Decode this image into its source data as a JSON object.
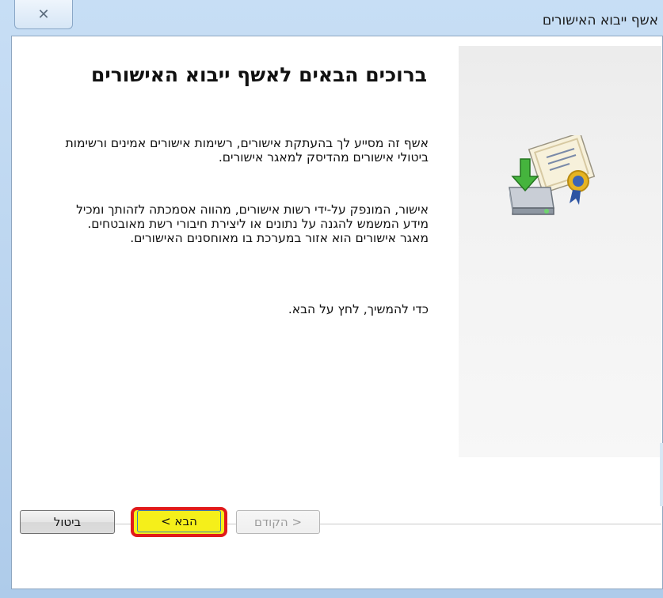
{
  "window": {
    "title": "אשף ייבוא האישורים",
    "close_glyph": "✕"
  },
  "main": {
    "heading": "ברוכים הבאים לאשף ייבוא האישורים",
    "paragraph1": "אשף זה מסייע לך בהעתקת אישורים, רשימות אישורים אמינים ורשימות ביטולי אישורים מהדיסק למאגר אישורים.",
    "paragraph2": "אישור, המונפק על-ידי רשות אישורים, מהווה אסמכתה לזהותך ומכיל מידע המשמש להגנה על נתונים או ליצירת חיבורי רשת מאובטחים. מאגר אישורים הוא אזור במערכת בו מאוחסנים האישורים.",
    "paragraph3": "כדי להמשיך, לחץ על הבא."
  },
  "buttons": {
    "cancel": "ביטול",
    "next": "הבא >",
    "back": "< הקודם"
  },
  "icons": {
    "side_image": "certificate-import-icon"
  },
  "colors": {
    "highlight_fill": "#f5ef1a",
    "highlight_ring": "#e01b1b"
  }
}
